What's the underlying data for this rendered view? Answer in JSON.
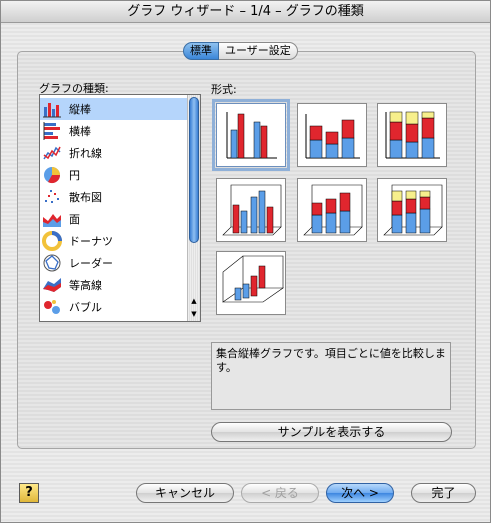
{
  "window": {
    "title": "グラフ ウィザード – 1/4 – グラフの種類"
  },
  "tabs": [
    {
      "label": "標準",
      "selected": true
    },
    {
      "label": "ユーザー設定",
      "selected": false
    }
  ],
  "chart_type_label": "グラフの種類:",
  "subtype_label": "形式:",
  "chart_types": [
    {
      "label": "縦棒",
      "icon": "column-chart-icon",
      "selected": true
    },
    {
      "label": "横棒",
      "icon": "bar-chart-icon",
      "selected": false
    },
    {
      "label": "折れ線",
      "icon": "line-chart-icon",
      "selected": false
    },
    {
      "label": "円",
      "icon": "pie-chart-icon",
      "selected": false
    },
    {
      "label": "散布図",
      "icon": "scatter-chart-icon",
      "selected": false
    },
    {
      "label": "面",
      "icon": "area-chart-icon",
      "selected": false
    },
    {
      "label": "ドーナツ",
      "icon": "doughnut-chart-icon",
      "selected": false
    },
    {
      "label": "レーダー",
      "icon": "radar-chart-icon",
      "selected": false
    },
    {
      "label": "等高線",
      "icon": "surface-chart-icon",
      "selected": false
    },
    {
      "label": "バブル",
      "icon": "bubble-chart-icon",
      "selected": false
    }
  ],
  "subtypes": [
    {
      "icon": "clustered-column-icon",
      "selected": true
    },
    {
      "icon": "stacked-column-icon",
      "selected": false
    },
    {
      "icon": "100-percent-stacked-column-icon",
      "selected": false
    },
    {
      "icon": "3d-clustered-column-icon",
      "selected": false
    },
    {
      "icon": "3d-stacked-column-icon",
      "selected": false
    },
    {
      "icon": "3d-100-percent-stacked-column-icon",
      "selected": false
    },
    {
      "icon": "3d-column-icon",
      "selected": false
    }
  ],
  "description": "集合縦棒グラフです。項目ごとに値を比較します。",
  "buttons": {
    "preview": "サンプルを表示する",
    "cancel": "キャンセル",
    "back": "< 戻る",
    "next": "次へ >",
    "finish": "完了",
    "help": "?"
  },
  "colors": {
    "red": "#e0262e",
    "blue": "#5b9ee8",
    "yellow": "#f7ef8c",
    "selection": "#b5d5fb"
  }
}
